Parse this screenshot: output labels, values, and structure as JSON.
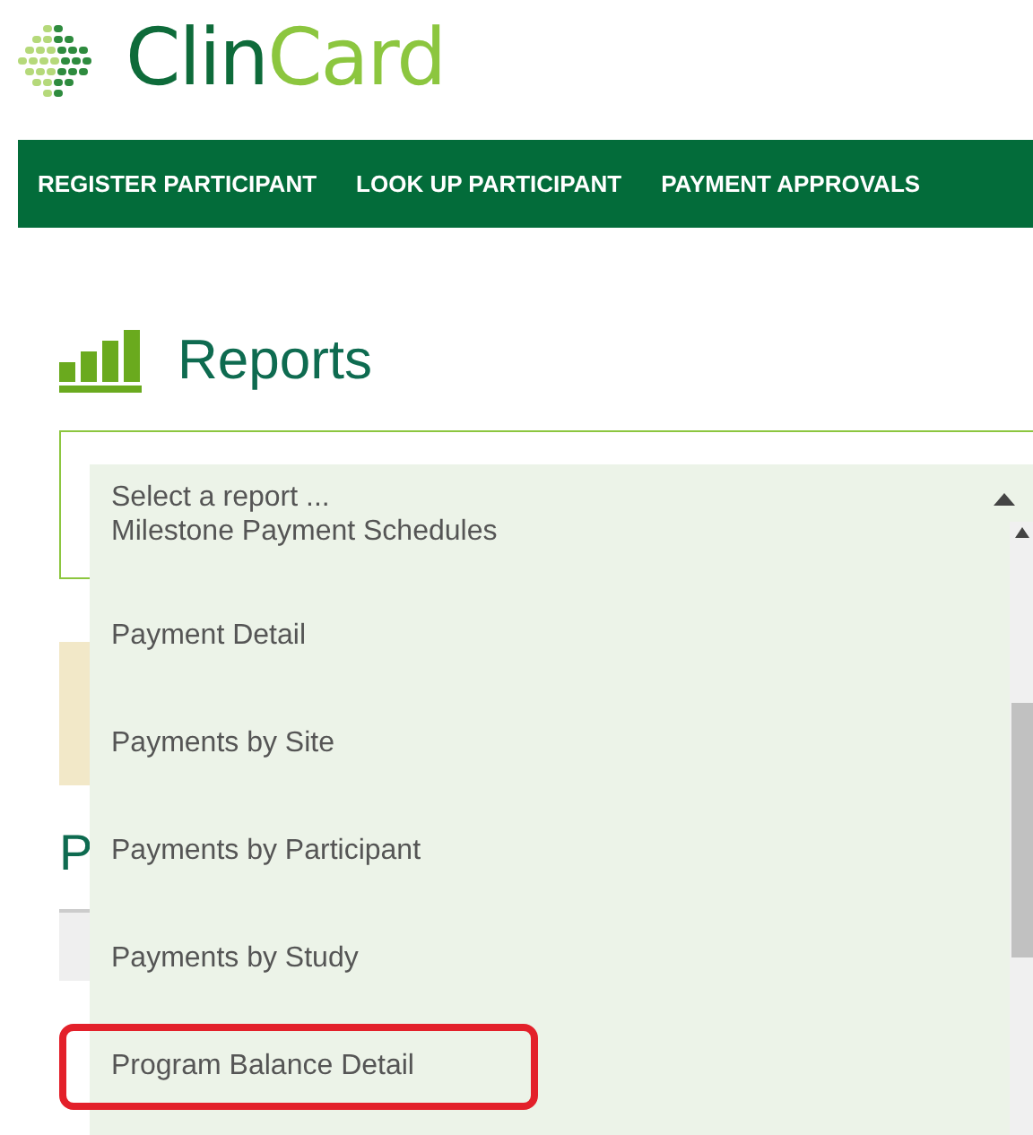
{
  "logo": {
    "parts": [
      "Clin",
      "Card"
    ]
  },
  "nav": [
    {
      "label": "REGISTER PARTICIPANT"
    },
    {
      "label": "LOOK UP PARTICIPANT"
    },
    {
      "label": "PAYMENT APPROVALS"
    }
  ],
  "page_title": "Reports",
  "background_heading": "P",
  "report_select": {
    "placeholder": "Select a report ...",
    "expanded": true,
    "options": [
      {
        "label": "Milestone Payment Schedules",
        "highlighted": false
      },
      {
        "label": "Payment Detail",
        "highlighted": false
      },
      {
        "label": "Payments by Site",
        "highlighted": false
      },
      {
        "label": "Payments by Participant",
        "highlighted": false
      },
      {
        "label": "Payments by Study",
        "highlighted": false
      },
      {
        "label": "Program Balance Detail",
        "highlighted": true
      }
    ]
  }
}
